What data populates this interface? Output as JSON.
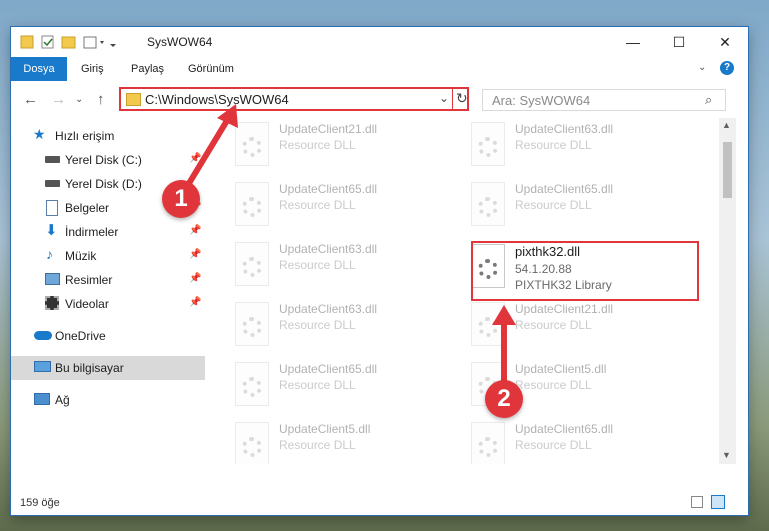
{
  "window": {
    "title": "SysWOW64"
  },
  "window_controls": {
    "minimize": "—",
    "maximize": "☐",
    "close": "✕"
  },
  "ribbon": {
    "tabs": [
      "Dosya",
      "Giriş",
      "Paylaş",
      "Görünüm"
    ]
  },
  "address": {
    "path": "C:\\Windows\\SysWOW64",
    "search_placeholder": "Ara: SysWOW64"
  },
  "sidebar": {
    "items": [
      {
        "label": "Hızlı erişim",
        "icon": "star-icon",
        "pinned": false
      },
      {
        "label": "Yerel Disk (C:)",
        "icon": "drive-icon",
        "pinned": true
      },
      {
        "label": "Yerel Disk (D:)",
        "icon": "drive-icon",
        "pinned": true
      },
      {
        "label": "Belgeler",
        "icon": "document-icon",
        "pinned": true
      },
      {
        "label": "İndirmeler",
        "icon": "download-icon",
        "pinned": true
      },
      {
        "label": "Müzik",
        "icon": "music-icon",
        "pinned": true
      },
      {
        "label": "Resimler",
        "icon": "pictures-icon",
        "pinned": true
      },
      {
        "label": "Videolar",
        "icon": "video-icon",
        "pinned": true
      },
      {
        "label": "OneDrive",
        "icon": "cloud-icon",
        "pinned": false
      },
      {
        "label": "Bu bilgisayar",
        "icon": "computer-icon",
        "pinned": false,
        "selected": true
      },
      {
        "label": "Ağ",
        "icon": "network-icon",
        "pinned": false
      }
    ]
  },
  "files": [
    {
      "name": "UpdateClient21.dll",
      "desc": "Resource DLL"
    },
    {
      "name": "UpdateClient63.dll",
      "desc": "Resource DLL"
    },
    {
      "name": "UpdateClient65.dll",
      "desc": "Resource DLL"
    },
    {
      "name": "UpdateClient65.dll",
      "desc": "Resource DLL"
    },
    {
      "name": "UpdateClient63.dll",
      "desc": "Resource DLL"
    },
    {
      "name": "pixthk32.dll",
      "desc": "54.1.20.88",
      "desc2": "PIXTHK32 Library"
    },
    {
      "name": "UpdateClient63.dll",
      "desc": "Resource DLL"
    },
    {
      "name": "UpdateClient21.dll",
      "desc": "Resource DLL"
    },
    {
      "name": "UpdateClient65.dll",
      "desc": "Resource DLL"
    },
    {
      "name": "UpdateClient5.dll",
      "desc": "Resource DLL"
    },
    {
      "name": "UpdateClient5.dll",
      "desc": "Resource DLL"
    },
    {
      "name": "UpdateClient65.dll",
      "desc": "Resource DLL"
    }
  ],
  "status": {
    "count": "159 öğe"
  },
  "annotations": {
    "step1": "1",
    "step2": "2",
    "color": "#e0353b"
  }
}
